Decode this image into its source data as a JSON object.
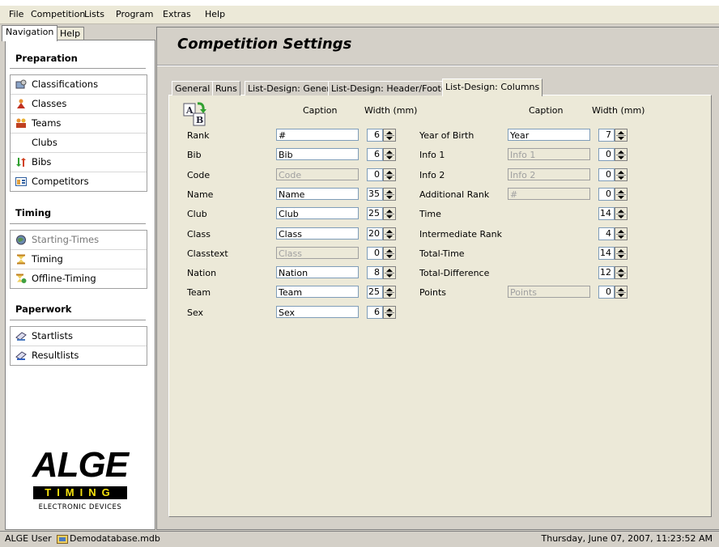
{
  "menu": [
    "File",
    "Competition",
    "Lists",
    "Program",
    "Extras",
    "Help"
  ],
  "left_tabs": {
    "navigation": "Navigation",
    "help": "Help"
  },
  "sidebar": {
    "preparation": {
      "title": "Preparation",
      "items": [
        {
          "label": "Classifications",
          "icon": "classifications-icon"
        },
        {
          "label": "Classes",
          "icon": "classes-icon"
        },
        {
          "label": "Teams",
          "icon": "teams-icon"
        },
        {
          "label": "Clubs",
          "icon": ""
        },
        {
          "label": "Bibs",
          "icon": "bibs-icon"
        },
        {
          "label": "Competitors",
          "icon": "competitors-icon"
        }
      ]
    },
    "timing": {
      "title": "Timing",
      "items": [
        {
          "label": "Starting-Times",
          "icon": "globe-icon",
          "disabled": true
        },
        {
          "label": "Timing",
          "icon": "hourglass-icon"
        },
        {
          "label": "Offline-Timing",
          "icon": "offline-timing-icon"
        }
      ]
    },
    "paperwork": {
      "title": "Paperwork",
      "items": [
        {
          "label": "Startlists",
          "icon": "startlists-icon"
        },
        {
          "label": "Resultlists",
          "icon": "resultlists-icon"
        }
      ]
    }
  },
  "logo": {
    "main": "ALGE",
    "bar": "TIMING",
    "sub": "ELECTRONIC DEVICES"
  },
  "main": {
    "title": "Competition Settings",
    "tabs": [
      "General",
      "Runs",
      "List-Design: General",
      "List-Design: Header/Footer",
      "List-Design: Columns"
    ],
    "active_tab": "List-Design: Columns",
    "headers": {
      "caption": "Caption",
      "width": "Width (mm)"
    },
    "left_rows": [
      {
        "label": "Rank",
        "caption": "#",
        "width": "6",
        "enabled": true
      },
      {
        "label": "Bib",
        "caption": "Bib",
        "width": "6",
        "enabled": true
      },
      {
        "label": "Code",
        "caption": "Code",
        "width": "0",
        "enabled": false
      },
      {
        "label": "Name",
        "caption": "Name",
        "width": "35",
        "enabled": true
      },
      {
        "label": "Club",
        "caption": "Club",
        "width": "25",
        "enabled": true
      },
      {
        "label": "Class",
        "caption": "Class",
        "width": "20",
        "enabled": true
      },
      {
        "label": "Classtext",
        "caption": "Class",
        "width": "0",
        "enabled": false
      },
      {
        "label": "Nation",
        "caption": "Nation",
        "width": "8",
        "enabled": true
      },
      {
        "label": "Team",
        "caption": "Team",
        "width": "25",
        "enabled": true
      },
      {
        "label": "Sex",
        "caption": "Sex",
        "width": "6",
        "enabled": true
      }
    ],
    "right_rows": [
      {
        "label": "Year of Birth",
        "caption": "Year",
        "width": "7",
        "enabled": true
      },
      {
        "label": "Info 1",
        "caption": "Info 1",
        "width": "0",
        "enabled": false
      },
      {
        "label": "Info 2",
        "caption": "Info 2",
        "width": "0",
        "enabled": false
      },
      {
        "label": "Additional Rank",
        "caption": "#",
        "width": "0",
        "enabled": false
      },
      {
        "label": "Time",
        "caption": null,
        "width": "14",
        "enabled": true
      },
      {
        "label": "Intermediate Rank",
        "caption": null,
        "width": "4",
        "enabled": true
      },
      {
        "label": "Total-Time",
        "caption": null,
        "width": "14",
        "enabled": true
      },
      {
        "label": "Total-Difference",
        "caption": null,
        "width": "12",
        "enabled": true
      },
      {
        "label": "Points",
        "caption": "Points",
        "width": "0",
        "enabled": false
      }
    ]
  },
  "status": {
    "user": "ALGE User",
    "database": "Demodatabase.mdb",
    "datetime": "Thursday, June 07, 2007, 11:23:52 AM"
  }
}
